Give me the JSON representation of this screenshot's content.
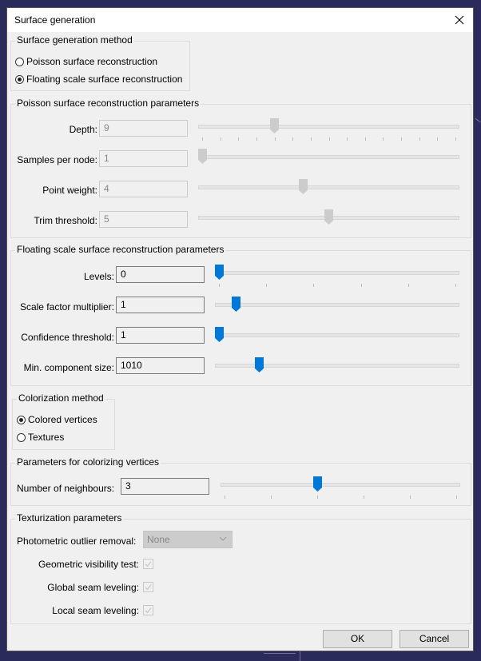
{
  "window": {
    "title": "Surface generation",
    "close_label": "close"
  },
  "method_group": {
    "title": "Surface generation method",
    "options": [
      {
        "label": "Poisson surface reconstruction",
        "selected": false
      },
      {
        "label": "Floating scale surface reconstruction",
        "selected": true
      }
    ]
  },
  "poisson_group": {
    "title": "Poisson surface reconstruction parameters",
    "enabled": false,
    "params": [
      {
        "label": "Depth:",
        "value": "9",
        "slider_fraction": 0.2857,
        "ticks": 15
      },
      {
        "label": "Samples per node:",
        "value": "1",
        "slider_fraction": 0.0,
        "ticks": 0
      },
      {
        "label": "Point weight:",
        "value": "4",
        "slider_fraction": 0.4,
        "ticks": 0
      },
      {
        "label": "Trim threshold:",
        "value": "5",
        "slider_fraction": 0.5,
        "ticks": 0
      }
    ]
  },
  "fssr_group": {
    "title": "Floating scale surface reconstruction parameters",
    "enabled": true,
    "params": [
      {
        "label": "Levels:",
        "value": "0",
        "slider_fraction": 0.0,
        "ticks": 6
      },
      {
        "label": "Scale factor multiplier:",
        "value": "1",
        "slider_fraction": 0.07,
        "ticks": 0
      },
      {
        "label": "Confidence threshold:",
        "value": "1",
        "slider_fraction": 0.0,
        "ticks": 0
      },
      {
        "label": "Min. component size:",
        "value": "1010",
        "slider_fraction": 0.17,
        "ticks": 0
      }
    ]
  },
  "colorization_group": {
    "title": "Colorization method",
    "options": [
      {
        "label": "Colored vertices",
        "selected": true
      },
      {
        "label": "Textures",
        "selected": false
      }
    ]
  },
  "vertex_color_group": {
    "title": "Parameters for colorizing vertices",
    "params": [
      {
        "label": "Number of neighbours:",
        "value": "3",
        "slider_fraction": 0.4,
        "ticks": 6
      }
    ]
  },
  "texturization_group": {
    "title": "Texturization parameters",
    "photometric_label": "Photometric outlier removal:",
    "photometric_value": "None",
    "checks": [
      {
        "label": "Geometric visibility test:",
        "checked": true
      },
      {
        "label": "Global seam leveling:",
        "checked": true
      },
      {
        "label": "Local seam leveling:",
        "checked": true
      }
    ]
  },
  "buttons": {
    "ok": "OK",
    "cancel": "Cancel"
  },
  "colors": {
    "accent": "#0078d7",
    "disabled_thumb": "#cccccc",
    "background": "#2b2b5b",
    "dialog": "#f0f0f0"
  }
}
